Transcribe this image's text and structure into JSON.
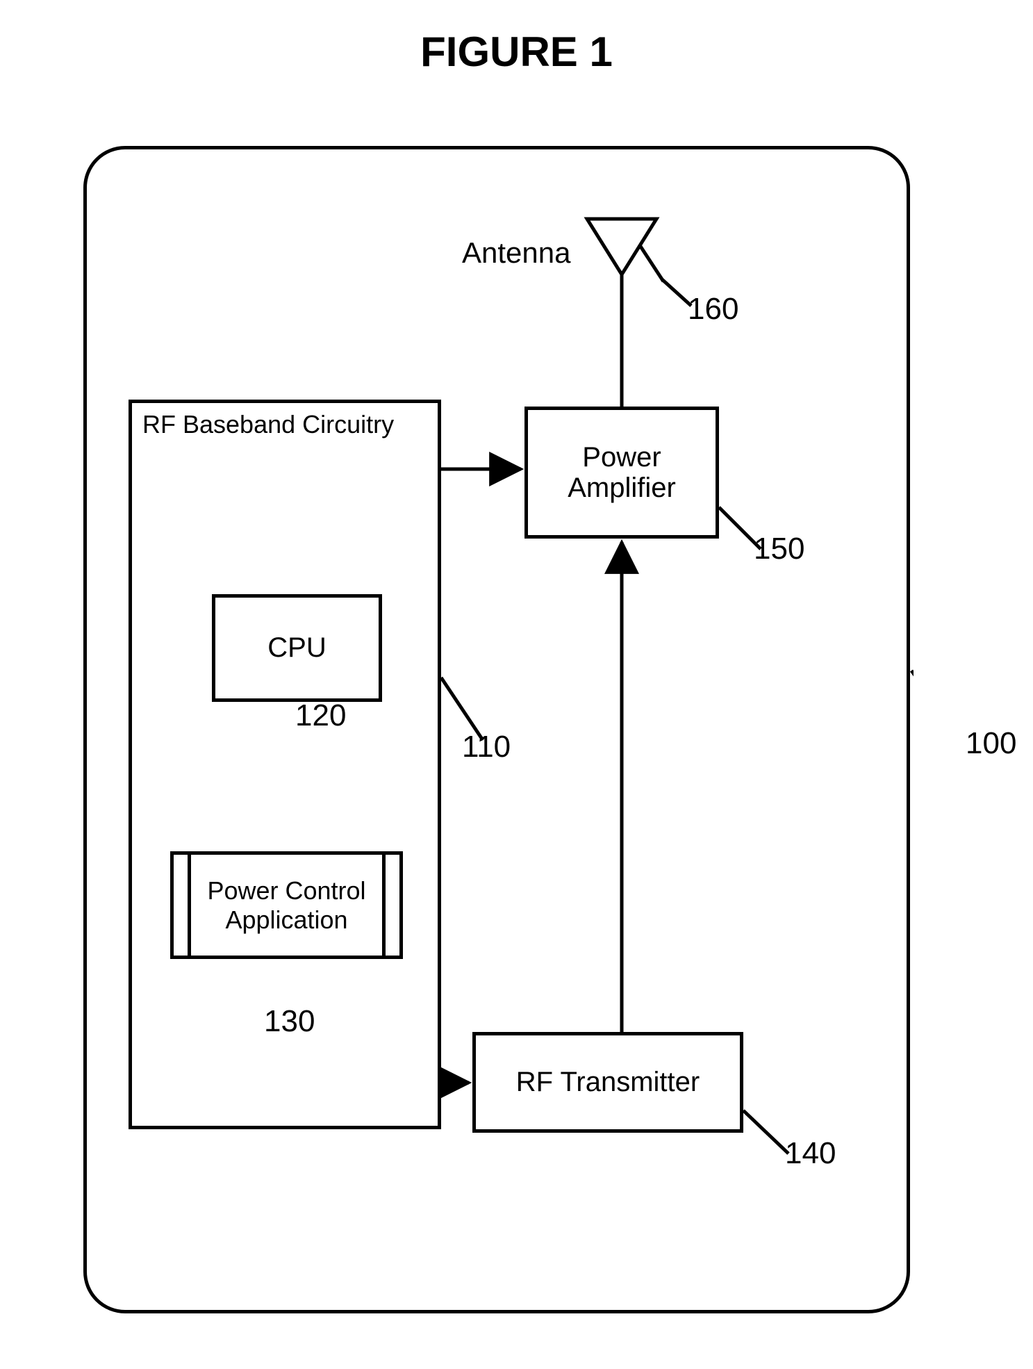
{
  "title": "FIGURE 1",
  "baseband": {
    "label": "RF Baseband Circuitry"
  },
  "cpu": {
    "label": "CPU"
  },
  "pca": {
    "label": "Power Control Application"
  },
  "power_amp": {
    "label": "Power Amplifier"
  },
  "rf_tx": {
    "label": "RF Transmitter"
  },
  "antenna": {
    "label": "Antenna"
  },
  "refs": {
    "system": "100",
    "baseband": "110",
    "cpu": "120",
    "pca": "130",
    "rf_tx": "140",
    "power_amp": "150",
    "antenna": "160"
  }
}
